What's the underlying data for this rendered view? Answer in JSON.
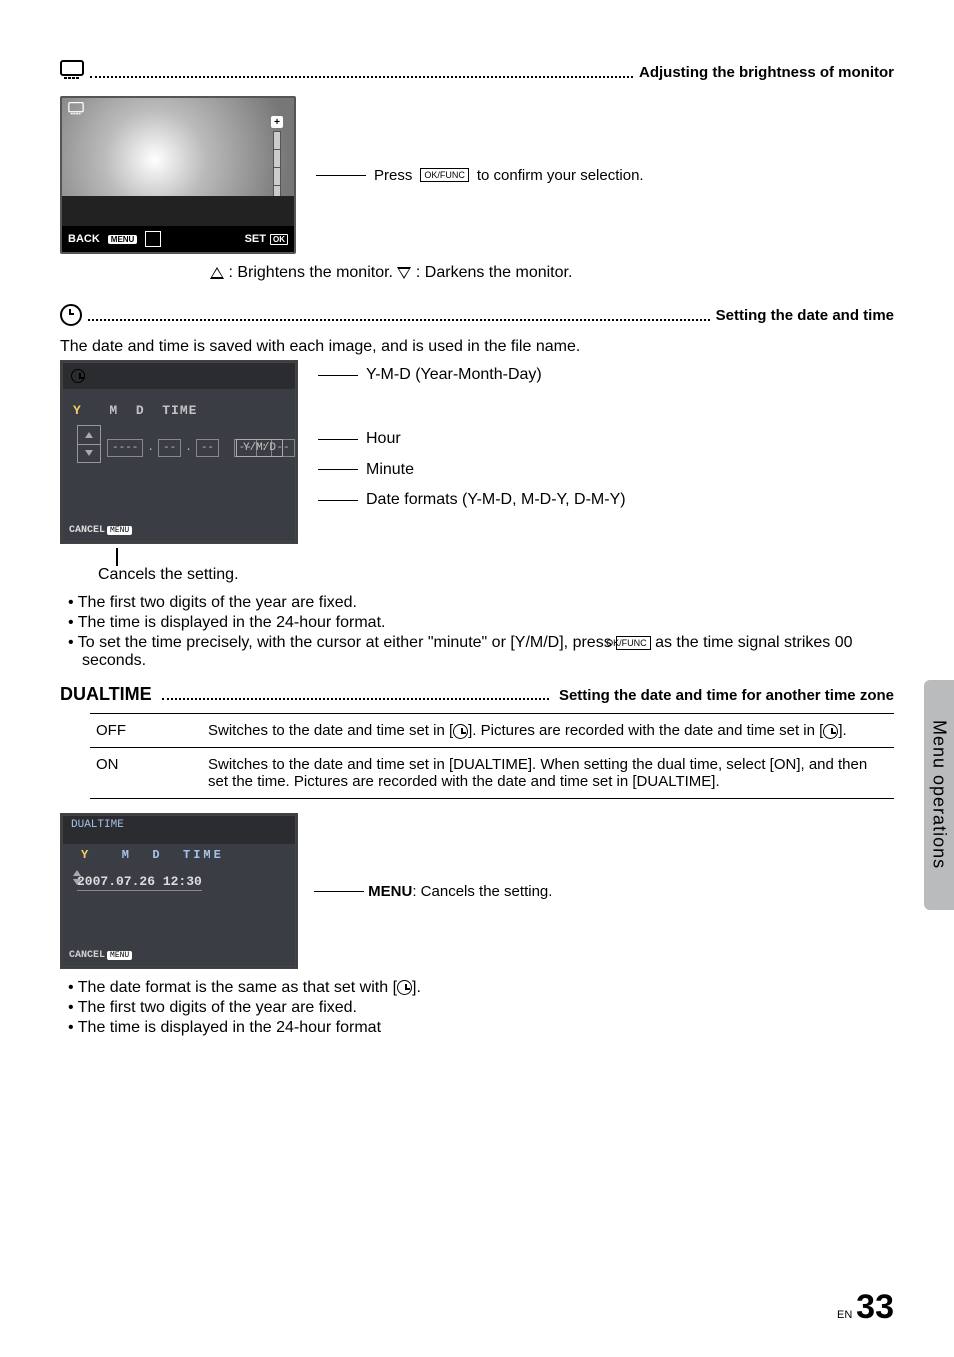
{
  "brightness_section": {
    "heading_right": "Adjusting the brightness of monitor",
    "back_label": "BACK",
    "set_label": "SET",
    "ok_label": "OK",
    "confirm_line_prefix": "Press ",
    "okfunc_label": "OK/FUNC",
    "confirm_line_suffix": " to confirm your selection.",
    "brighten_text": ": Brightens the monitor. ",
    "darken_text": ": Darkens the monitor."
  },
  "datetime_section": {
    "heading_right": "Setting the date and time",
    "intro": "The date and time is saved with each image, and is used in the file name.",
    "ymd_label": "Y-M-D (Year-Month-Day)",
    "hour_label": "Hour",
    "minute_label": "Minute",
    "formats_label": "Date formats (Y-M-D, M-D-Y, D-M-Y)",
    "cancel_caption": "Cancels the setting.",
    "lcd_header_letters": "Y  M  D  TIME",
    "lcd_ymd_box": "Y/M/D",
    "lcd_cancel": "CANCEL",
    "lcd_menu": "MENU",
    "bullets": [
      "The first two digits of the year are fixed.",
      "The time is displayed in the 24-hour format.",
      "To set the time precisely, with the cursor at either \"minute\" or [Y/M/D], press  OK/FUNC  as the time signal strikes 00 seconds."
    ],
    "bullet3_pre": "To set the time precisely, with the cursor at either \"minute\" or [Y/M/D], press ",
    "bullet3_btn": "OK/FUNC",
    "bullet3_post": " as the time signal strikes 00 seconds."
  },
  "dualtime_section": {
    "title": "DUALTIME",
    "heading_right": "Setting the date and time for another time zone",
    "rows": {
      "off_key": "OFF",
      "off_text_pre": "Switches to the date and time set in [",
      "off_text_mid": "]. Pictures are recorded with the date and time set in [",
      "off_text_post": "].",
      "on_key": "ON",
      "on_text": "Switches to the date and time set in [DUALTIME]. When setting the dual time, select [ON], and then set the time. Pictures are recorded with the date and time set in [DUALTIME]."
    },
    "lcd": {
      "title": "DUALTIME",
      "row_labels": "Y   M  D  TIME",
      "date_value": "2007.07.26 12:30",
      "cancel": "CANCEL",
      "menu": "MENU"
    },
    "menu_cancel_label_bold": "MENU",
    "menu_cancel_label_rest": ": Cancels the setting.",
    "bullets_pre": "The date format is the same as that set with [",
    "bullets_post": "].",
    "bullets": [
      "The first two digits of the year are fixed.",
      "The time is displayed in the 24-hour format"
    ]
  },
  "side_tab": "Menu operations",
  "page_en": "EN",
  "page_number": "33"
}
